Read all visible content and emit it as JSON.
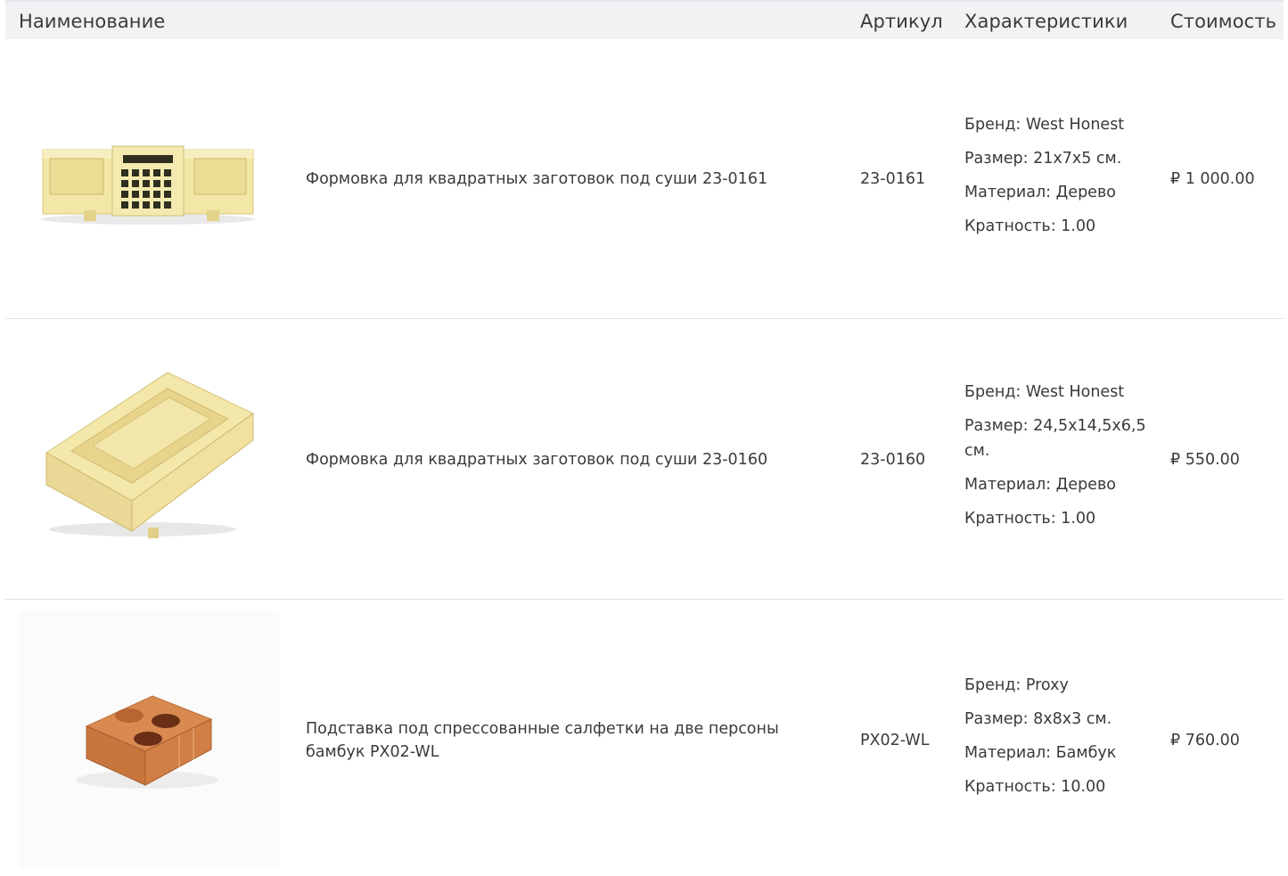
{
  "table": {
    "headers": {
      "name": "Наименование",
      "sku": "Артикул",
      "specs": "Характеристики",
      "price": "Стоимость"
    },
    "rows": [
      {
        "name": "Формовка для квадратных заготовок под суши 23-0161",
        "sku": "23-0161",
        "specs": [
          "Бренд: West Honest",
          "Размер: 21x7x5 см.",
          "Материал: Дерево",
          "Кратность: 1.00"
        ],
        "price": "₽ 1 000.00",
        "image": "wooden-sushi-press-long"
      },
      {
        "name": "Формовка для квадратных заготовок под суши 23-0160",
        "sku": "23-0160",
        "specs": [
          "Бренд: West Honest",
          "Размер: 24,5x14,5x6,5 см.",
          "Материал: Дерево",
          "Кратность: 1.00"
        ],
        "price": "₽ 550.00",
        "image": "wooden-sushi-press-box"
      },
      {
        "name": "Подставка под спрессованные салфетки на две персоны бамбук PX02-WL",
        "sku": "PX02-WL",
        "specs": [
          "Бренд: Proxy",
          "Размер: 8x8x3 см.",
          "Материал: Бамбук",
          "Кратность: 10.00"
        ],
        "price": "₽ 760.00",
        "image": "bamboo-napkin-stand"
      }
    ]
  }
}
